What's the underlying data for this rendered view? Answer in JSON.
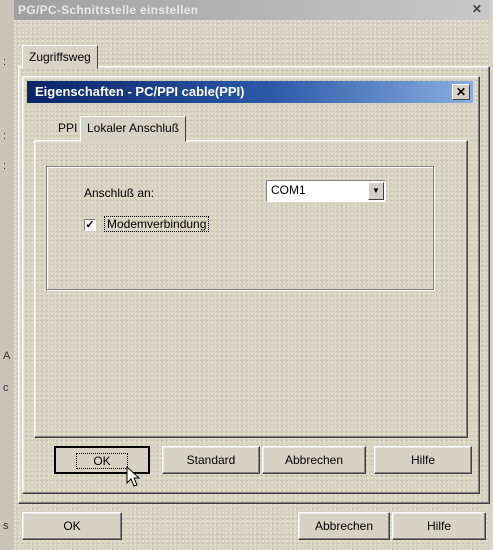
{
  "outer_window": {
    "title": "PG/PC-Schnittstelle einstellen",
    "close_glyph": "✕",
    "tab_label": "Zugriffsweg",
    "ok_label": "OK",
    "cancel_label": "Abbrechen",
    "help_label": "Hilfe"
  },
  "inner_dialog": {
    "title": "Eigenschaften - PC/PPI cable(PPI)",
    "close_glyph": "✕",
    "tabs": [
      {
        "label": "PPI"
      },
      {
        "label": "Lokaler Anschluß"
      }
    ],
    "port_label": "Anschluß an:",
    "port_value": "COM1",
    "modem_label": "Modemverbindung",
    "modem_checked": true,
    "check_glyph": "✓",
    "ok_label": "OK",
    "standard_label": "Standard",
    "cancel_label": "Abbrechen",
    "help_label": "Hilfe"
  },
  "left_strip": {
    "chars": [
      ":",
      ":",
      ":",
      "A",
      "c",
      "s"
    ]
  }
}
